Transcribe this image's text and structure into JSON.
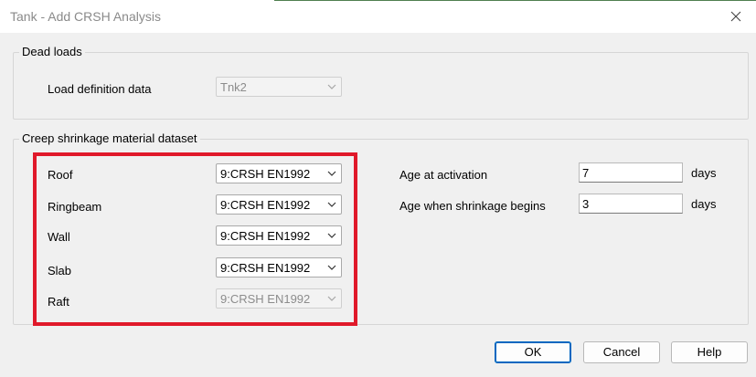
{
  "window": {
    "title": "Tank - Add CRSH Analysis"
  },
  "dead_loads": {
    "group_label": "Dead loads",
    "load_definition_label": "Load definition data",
    "load_definition_value": "Tnk2"
  },
  "creep": {
    "group_label": "Creep  shrinkage material dataset",
    "rows": [
      {
        "label": "Roof",
        "value": "9:CRSH EN1992"
      },
      {
        "label": "Ringbeam",
        "value": "9:CRSH EN1992"
      },
      {
        "label": "Wall",
        "value": "9:CRSH EN1992"
      },
      {
        "label": "Slab",
        "value": "9:CRSH EN1992"
      },
      {
        "label": "Raft",
        "value": "9:CRSH EN1992"
      }
    ],
    "age_activation_label": "Age at activation",
    "age_activation_value": "7",
    "age_activation_unit": "days",
    "age_shrinkage_label": "Age when shrinkage begins",
    "age_shrinkage_value": "3",
    "age_shrinkage_unit": "days"
  },
  "buttons": {
    "ok": "OK",
    "cancel": "Cancel",
    "help": "Help"
  },
  "colors": {
    "highlight": "#e0192a",
    "default_button_border": "#0067c0"
  }
}
